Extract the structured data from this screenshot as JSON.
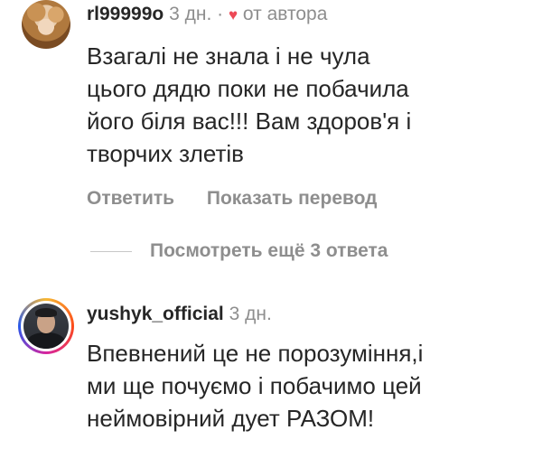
{
  "comments": [
    {
      "username": "rl99999o",
      "time": "3 дн.",
      "separator": "·",
      "heart": "♥",
      "author_note": "от автора",
      "text": "Взагалі не знала і не чула\nцього дядю поки не побачила\nйого біля вас!!! Вам здоров'я і\nтворчих злетів",
      "actions": {
        "reply": "Ответить",
        "translate": "Показать перевод"
      },
      "view_replies": "Посмотреть ещё 3 ответа"
    },
    {
      "username": "yushyk_official",
      "time": "3 дн.",
      "text": "Впевнений це не порозуміння,і\nми ще почуємо і побачимо цей\nнеймовірний дует РАЗОМ!"
    }
  ],
  "colors": {
    "text": "#262626",
    "meta": "#8e8e8e",
    "heart": "#ed4956"
  }
}
